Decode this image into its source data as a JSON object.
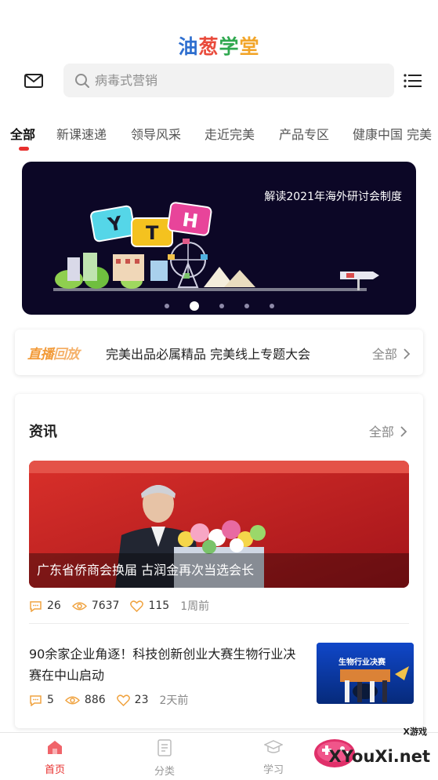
{
  "app": {
    "logo_chars": [
      "油",
      "葱",
      "学",
      "堂"
    ],
    "logo_colors": [
      "#2f6fcf",
      "#e94b3c",
      "#2fa84f",
      "#f2a529"
    ]
  },
  "search": {
    "placeholder": "病毒式营销",
    "icon": "search-icon"
  },
  "header_icons": {
    "mail": "mail-icon",
    "menu": "menu-icon"
  },
  "categories": [
    {
      "label": "全部"
    },
    {
      "label": "新课速递"
    },
    {
      "label": "领导风采"
    },
    {
      "label": "走近完美"
    },
    {
      "label": "产品专区"
    },
    {
      "label": "健康中国 完美"
    }
  ],
  "banner": {
    "caption": "解读2021年海外研讨会制度",
    "letters": [
      "Y",
      "T",
      "H"
    ],
    "dot_count": 5,
    "active_dot": 1
  },
  "live": {
    "logo_part1": "直播",
    "logo_part2": "回放",
    "title": "完美出品必属精品 完美线上专题大会",
    "more": "全部"
  },
  "news": {
    "heading": "资讯",
    "more": "全部",
    "featured": {
      "caption": "广东省侨商会换届 古润金再次当选会长",
      "comments": "26",
      "views": "7637",
      "likes": "115",
      "time": "1周前"
    },
    "second": {
      "title": "90余家企业角逐！科技创新创业大赛生物行业决赛在中山启动",
      "comments": "5",
      "views": "886",
      "likes": "23",
      "time": "2天前",
      "thumb_caption": "生物行业决赛"
    }
  },
  "bottom_nav": [
    {
      "label": "首页",
      "icon": "home-icon",
      "active": true
    },
    {
      "label": "分类",
      "icon": "category-icon",
      "active": false
    },
    {
      "label": "学习",
      "icon": "study-icon",
      "active": false
    }
  ],
  "watermark": {
    "text": "XYouXi.net",
    "small": "X游戏"
  },
  "colors": {
    "accent": "#e8302e",
    "live_orange": "#f29a38",
    "banner_bg": "#0c0726"
  }
}
